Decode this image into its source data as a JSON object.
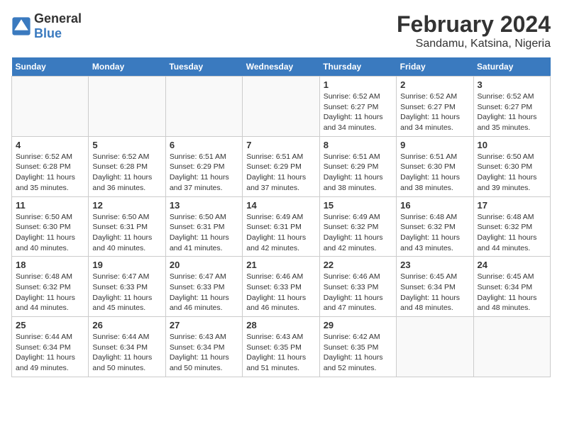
{
  "header": {
    "logo_general": "General",
    "logo_blue": "Blue",
    "title": "February 2024",
    "subtitle": "Sandamu, Katsina, Nigeria"
  },
  "days_of_week": [
    "Sunday",
    "Monday",
    "Tuesday",
    "Wednesday",
    "Thursday",
    "Friday",
    "Saturday"
  ],
  "weeks": [
    [
      {
        "day": "",
        "text": ""
      },
      {
        "day": "",
        "text": ""
      },
      {
        "day": "",
        "text": ""
      },
      {
        "day": "",
        "text": ""
      },
      {
        "day": "1",
        "text": "Sunrise: 6:52 AM\nSunset: 6:27 PM\nDaylight: 11 hours and 34 minutes."
      },
      {
        "day": "2",
        "text": "Sunrise: 6:52 AM\nSunset: 6:27 PM\nDaylight: 11 hours and 34 minutes."
      },
      {
        "day": "3",
        "text": "Sunrise: 6:52 AM\nSunset: 6:27 PM\nDaylight: 11 hours and 35 minutes."
      }
    ],
    [
      {
        "day": "4",
        "text": "Sunrise: 6:52 AM\nSunset: 6:28 PM\nDaylight: 11 hours and 35 minutes."
      },
      {
        "day": "5",
        "text": "Sunrise: 6:52 AM\nSunset: 6:28 PM\nDaylight: 11 hours and 36 minutes."
      },
      {
        "day": "6",
        "text": "Sunrise: 6:51 AM\nSunset: 6:29 PM\nDaylight: 11 hours and 37 minutes."
      },
      {
        "day": "7",
        "text": "Sunrise: 6:51 AM\nSunset: 6:29 PM\nDaylight: 11 hours and 37 minutes."
      },
      {
        "day": "8",
        "text": "Sunrise: 6:51 AM\nSunset: 6:29 PM\nDaylight: 11 hours and 38 minutes."
      },
      {
        "day": "9",
        "text": "Sunrise: 6:51 AM\nSunset: 6:30 PM\nDaylight: 11 hours and 38 minutes."
      },
      {
        "day": "10",
        "text": "Sunrise: 6:50 AM\nSunset: 6:30 PM\nDaylight: 11 hours and 39 minutes."
      }
    ],
    [
      {
        "day": "11",
        "text": "Sunrise: 6:50 AM\nSunset: 6:30 PM\nDaylight: 11 hours and 40 minutes."
      },
      {
        "day": "12",
        "text": "Sunrise: 6:50 AM\nSunset: 6:31 PM\nDaylight: 11 hours and 40 minutes."
      },
      {
        "day": "13",
        "text": "Sunrise: 6:50 AM\nSunset: 6:31 PM\nDaylight: 11 hours and 41 minutes."
      },
      {
        "day": "14",
        "text": "Sunrise: 6:49 AM\nSunset: 6:31 PM\nDaylight: 11 hours and 42 minutes."
      },
      {
        "day": "15",
        "text": "Sunrise: 6:49 AM\nSunset: 6:32 PM\nDaylight: 11 hours and 42 minutes."
      },
      {
        "day": "16",
        "text": "Sunrise: 6:48 AM\nSunset: 6:32 PM\nDaylight: 11 hours and 43 minutes."
      },
      {
        "day": "17",
        "text": "Sunrise: 6:48 AM\nSunset: 6:32 PM\nDaylight: 11 hours and 44 minutes."
      }
    ],
    [
      {
        "day": "18",
        "text": "Sunrise: 6:48 AM\nSunset: 6:32 PM\nDaylight: 11 hours and 44 minutes."
      },
      {
        "day": "19",
        "text": "Sunrise: 6:47 AM\nSunset: 6:33 PM\nDaylight: 11 hours and 45 minutes."
      },
      {
        "day": "20",
        "text": "Sunrise: 6:47 AM\nSunset: 6:33 PM\nDaylight: 11 hours and 46 minutes."
      },
      {
        "day": "21",
        "text": "Sunrise: 6:46 AM\nSunset: 6:33 PM\nDaylight: 11 hours and 46 minutes."
      },
      {
        "day": "22",
        "text": "Sunrise: 6:46 AM\nSunset: 6:33 PM\nDaylight: 11 hours and 47 minutes."
      },
      {
        "day": "23",
        "text": "Sunrise: 6:45 AM\nSunset: 6:34 PM\nDaylight: 11 hours and 48 minutes."
      },
      {
        "day": "24",
        "text": "Sunrise: 6:45 AM\nSunset: 6:34 PM\nDaylight: 11 hours and 48 minutes."
      }
    ],
    [
      {
        "day": "25",
        "text": "Sunrise: 6:44 AM\nSunset: 6:34 PM\nDaylight: 11 hours and 49 minutes."
      },
      {
        "day": "26",
        "text": "Sunrise: 6:44 AM\nSunset: 6:34 PM\nDaylight: 11 hours and 50 minutes."
      },
      {
        "day": "27",
        "text": "Sunrise: 6:43 AM\nSunset: 6:34 PM\nDaylight: 11 hours and 50 minutes."
      },
      {
        "day": "28",
        "text": "Sunrise: 6:43 AM\nSunset: 6:35 PM\nDaylight: 11 hours and 51 minutes."
      },
      {
        "day": "29",
        "text": "Sunrise: 6:42 AM\nSunset: 6:35 PM\nDaylight: 11 hours and 52 minutes."
      },
      {
        "day": "",
        "text": ""
      },
      {
        "day": "",
        "text": ""
      }
    ]
  ]
}
